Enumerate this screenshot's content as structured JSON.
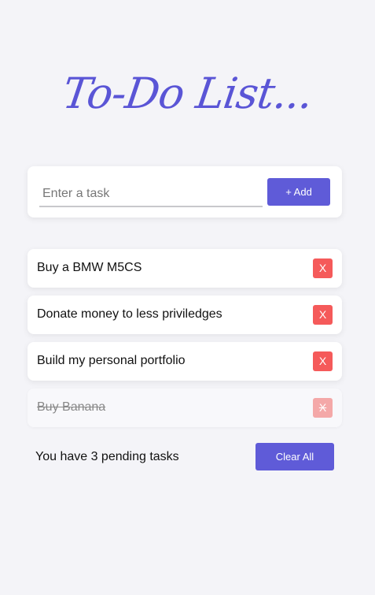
{
  "app": {
    "title": "To-Do List..."
  },
  "input": {
    "placeholder": "Enter a task",
    "value": ""
  },
  "add_button": {
    "label": "+ Add"
  },
  "tasks": [
    {
      "text": "Buy a BMW M5CS",
      "completed": false,
      "delete_label": "X"
    },
    {
      "text": "Donate money to less priviledges",
      "completed": false,
      "delete_label": "X"
    },
    {
      "text": "Build my personal portfolio",
      "completed": false,
      "delete_label": "X"
    },
    {
      "text": "Buy Banana",
      "completed": true,
      "delete_label": "X"
    }
  ],
  "footer": {
    "pending_text": "You have 3 pending tasks",
    "clear_label": "Clear All"
  },
  "colors": {
    "accent": "#5f5bd8",
    "delete": "#f55a5a",
    "background": "#f4f4f8"
  }
}
